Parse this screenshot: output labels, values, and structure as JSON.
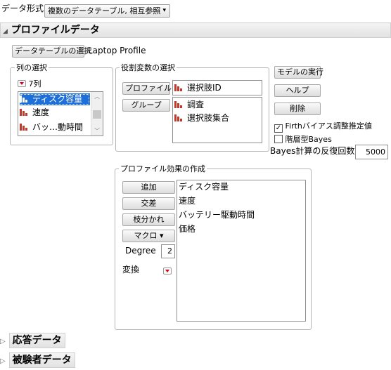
{
  "data_format": {
    "label": "データ形式",
    "selected": "複数のデータテーブル, 相互参照"
  },
  "profile_section": {
    "title": "プロファイルデータ"
  },
  "select_table": {
    "button": "データテーブルの選択",
    "table_name": "Laptop Profile"
  },
  "column_select": {
    "title": "列の選択",
    "count": "7列",
    "items": [
      "ディスク容量",
      "速度",
      "バッ…動時間"
    ]
  },
  "role_select": {
    "title": "役割変数の選択",
    "profile_id_button": "プロファイルID",
    "profile_id_value": "選択肢ID",
    "group_button": "グループ",
    "group_values": [
      "調査",
      "選択肢集合"
    ]
  },
  "actions": {
    "run": "モデルの実行",
    "help": "ヘルプ",
    "remove": "削除",
    "firth_label": "Firthバイアス調整推定値",
    "firth_checked": true,
    "bayes_label": "階層型Bayes",
    "bayes_checked": false,
    "bayes_iter_label": "Bayes計算の反復回数",
    "bayes_iter_value": "5000"
  },
  "effects": {
    "title": "プロファイル効果の作成",
    "add": "追加",
    "cross": "交差",
    "nest": "枝分かれ",
    "macro": "マクロ ▾",
    "degree_label": "Degree",
    "degree_value": "2",
    "transform_label": "変換",
    "items": [
      "ディスク容量",
      "速度",
      "バッテリー駆動時間",
      "価格"
    ]
  },
  "response_section": {
    "title": "応答データ"
  },
  "subject_section": {
    "title": "被験者データ"
  },
  "colors": {
    "selection": "#1e6fd9",
    "bar_icon": "#c0392b",
    "red_triangle": "#d0021b"
  }
}
